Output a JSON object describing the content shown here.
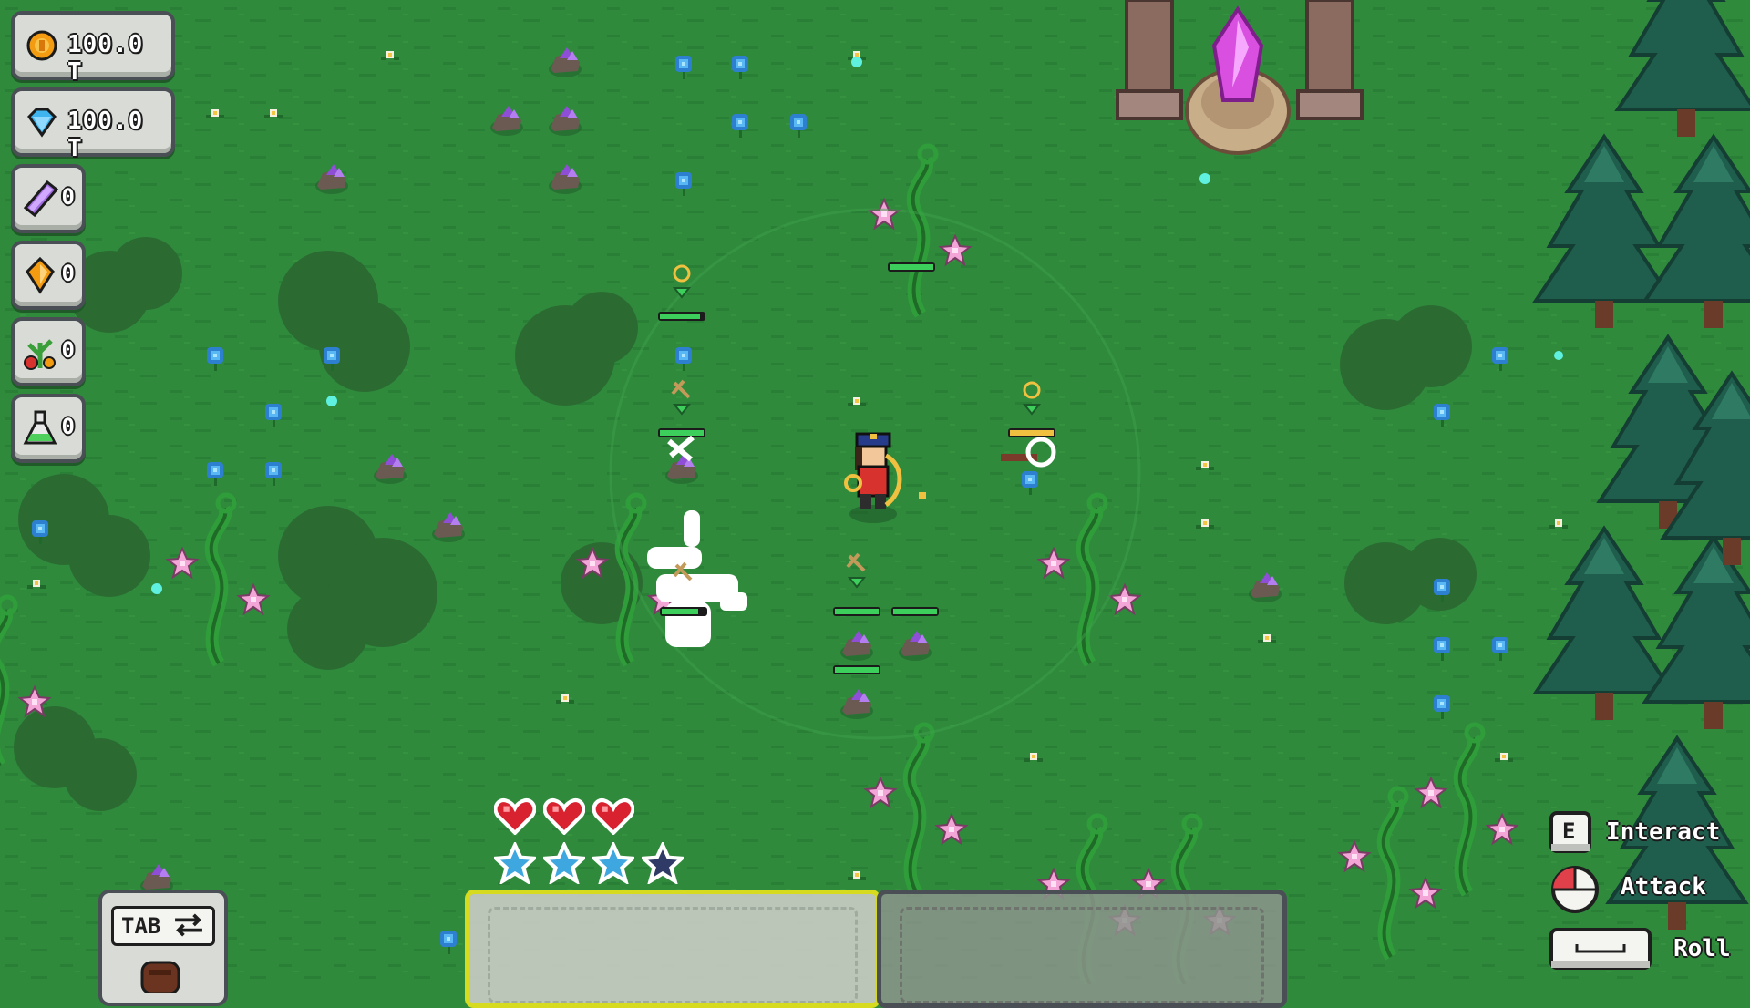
{
  "hud": {
    "currencies": [
      {
        "name": "coin-icon",
        "value": "100.0 T",
        "color": "#f39c12"
      },
      {
        "name": "diamond-icon",
        "value": "100.0 T",
        "color": "#3fb5f0"
      }
    ],
    "inventory": [
      {
        "name": "purple-crystal-icon",
        "count": "0"
      },
      {
        "name": "amber-gem-icon",
        "count": "0"
      },
      {
        "name": "plant-bundle-icon",
        "count": "0"
      },
      {
        "name": "potion-flask-icon",
        "count": "0"
      }
    ],
    "health": {
      "hearts_total": 3,
      "hearts_full": 3
    },
    "stamina": {
      "stars_total": 4,
      "stars_full": 3
    },
    "tab_key_label": "TAB"
  },
  "controls": [
    {
      "key": "E",
      "label": "Interact",
      "icon": "e-key-icon"
    },
    {
      "key": "",
      "label": "Attack",
      "icon": "mouse-icon"
    },
    {
      "key": "",
      "label": "Roll",
      "icon": "spacebar-icon"
    }
  ],
  "colors": {
    "grass": "#2f8a3c",
    "grass_dark": "#257431",
    "bush_shadow": "#2b6b32",
    "panel": "#d9dcd6",
    "panel_border": "#4a4f56",
    "crystal": "#d94fe0",
    "tree": "#1f5d4c",
    "heart": "#d8222f",
    "star": "#3fa7e0",
    "slot_highlight": "#e6e21e"
  }
}
